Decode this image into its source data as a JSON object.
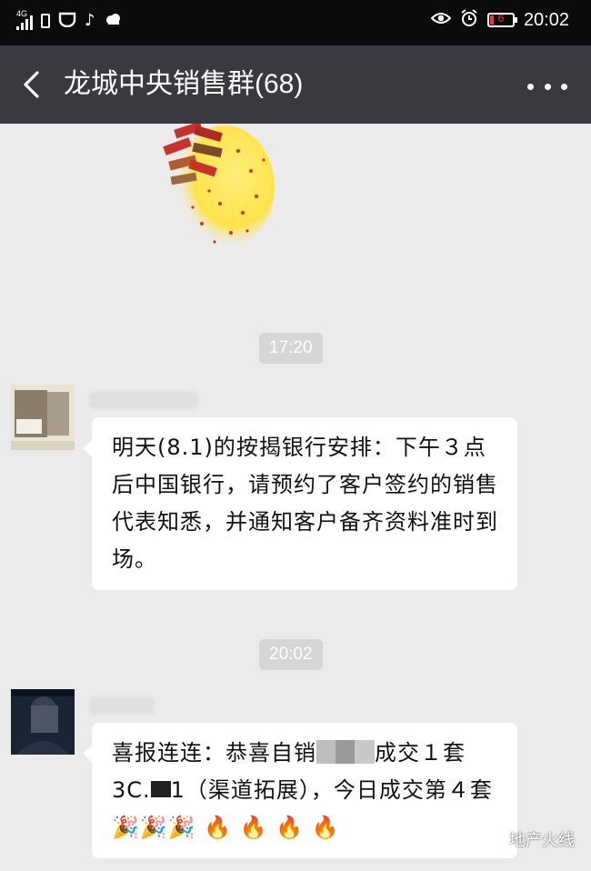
{
  "status_bar": {
    "network_label": "4G",
    "time": "20:02",
    "battery_level": "6",
    "icons": [
      "signal-icon",
      "sim-card-icon",
      "notification-icon",
      "tiktok-icon",
      "weather-icon",
      "eye-icon",
      "alarm-icon",
      "battery-icon"
    ]
  },
  "header": {
    "back_icon": "chevron-left-icon",
    "title": "龙城中央销售群(68)",
    "more_icon": "more-dots-icon"
  },
  "messages": [
    {
      "type": "timestamp",
      "text": "17:20"
    },
    {
      "type": "text",
      "text": "明天(8.1)的按揭银行安排：下午３点后中国银行，请预约了客户签约的销售代表知悉，并通知客户备齐资料准时到场。"
    },
    {
      "type": "timestamp",
      "text": "20:02"
    },
    {
      "type": "text",
      "text_part1": "喜报连连：恭喜自销",
      "text_part2": "成交１套3C.",
      "text_part3": "1（渠道拓展），今日成交第４套",
      "emoji": [
        "🎉",
        "🎉",
        "🎉",
        "🔥",
        "🔥",
        "🔥",
        "🔥"
      ]
    }
  ],
  "watermark": {
    "text": "地产火线",
    "icon": "wechat-channel-icon"
  },
  "colors": {
    "status_bar": "#0b0b0b",
    "title_bar": "#393a3f",
    "chat_background": "#ebebeb",
    "bubble": "#ffffff",
    "timestamp_pill": "#d6d6d6"
  }
}
